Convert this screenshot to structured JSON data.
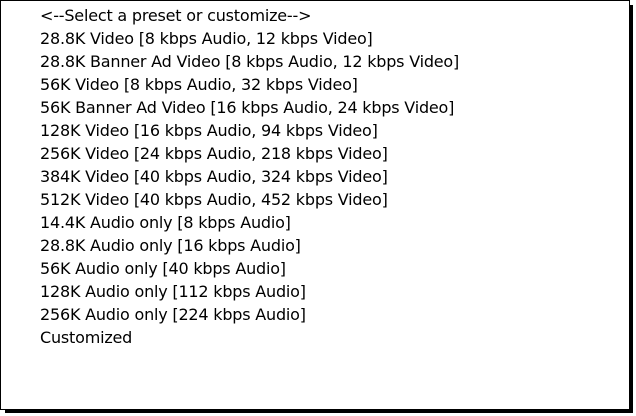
{
  "menu": {
    "items": [
      {
        "label": "<--Select a preset or customize-->"
      },
      {
        "label": "28.8K Video [8 kbps Audio, 12 kbps Video]"
      },
      {
        "label": "28.8K Banner Ad Video [8 kbps Audio, 12 kbps Video]"
      },
      {
        "label": "56K Video [8 kbps Audio, 32 kbps Video]"
      },
      {
        "label": "56K Banner Ad Video [16 kbps Audio, 24 kbps Video]"
      },
      {
        "label": "128K Video [16 kbps Audio, 94 kbps Video]"
      },
      {
        "label": "256K Video [24 kbps Audio, 218 kbps Video]"
      },
      {
        "label": "384K Video [40 kbps Audio, 324 kbps Video]"
      },
      {
        "label": "512K Video [40 kbps Audio, 452 kbps Video]"
      },
      {
        "label": "14.4K Audio only [8 kbps Audio]"
      },
      {
        "label": "28.8K Audio only [16 kbps Audio]"
      },
      {
        "label": "56K Audio only [40 kbps Audio]"
      },
      {
        "label": "128K Audio only [112 kbps Audio]"
      },
      {
        "label": "256K Audio only [224 kbps Audio]"
      },
      {
        "label": "Customized"
      }
    ]
  }
}
